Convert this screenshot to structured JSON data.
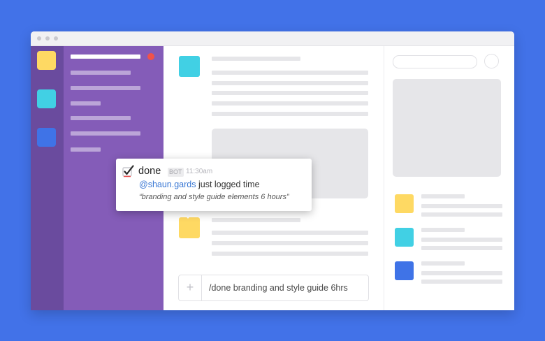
{
  "colors": {
    "background": "#4272e8",
    "team_rail": "#6a4b9e",
    "channel_pane": "#845cb8",
    "notification": "#f0524a",
    "yellow": "#fed963",
    "cyan": "#41d0e4",
    "blue": "#3f73e7",
    "mention": "#3a78d4"
  },
  "team_tiles": [
    {
      "icon": "yellow-team-tile"
    },
    {
      "icon": "cyan-team-tile"
    },
    {
      "icon": "blue-team-tile"
    }
  ],
  "popup": {
    "app_name": "done",
    "badge": "BOT",
    "time": "11:30am",
    "mention": "@shaun.gards",
    "message_rest": " just logged time",
    "quote": "“branding and style guide elements 6 hours”",
    "icon": "checkmark-icon"
  },
  "composer": {
    "plus_label": "+",
    "value": "/done branding and style guide 6hrs"
  }
}
